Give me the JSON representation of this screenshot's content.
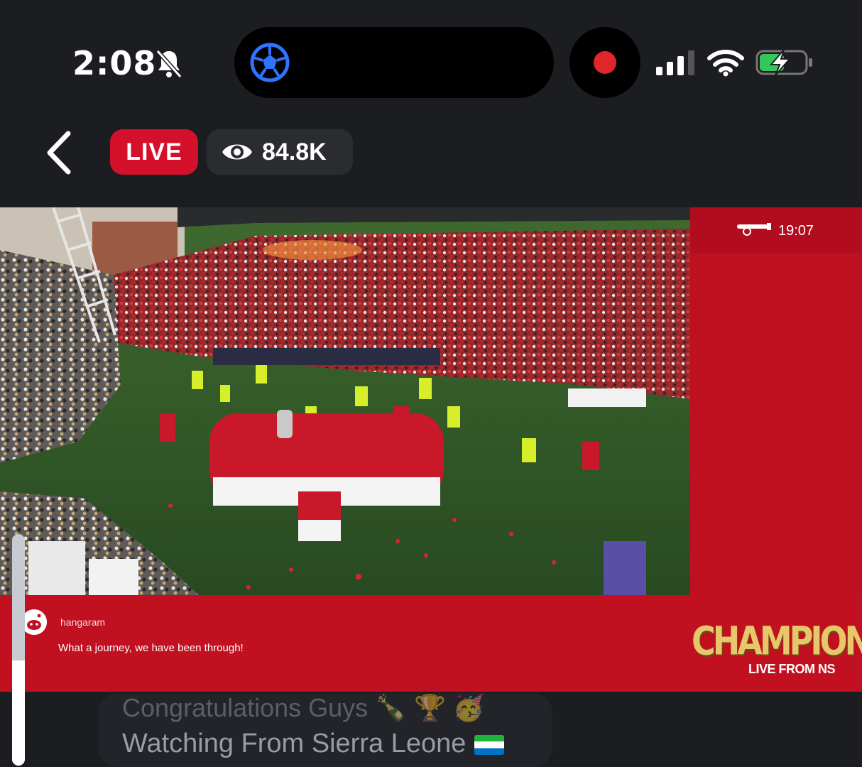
{
  "status_bar": {
    "time": "2:08",
    "icons": [
      "bell-slash-icon",
      "football-icon",
      "record-icon",
      "signal-icon",
      "wifi-icon",
      "battery-charging-icon"
    ]
  },
  "nav": {
    "back_icon": "chevron-left-icon",
    "live_label": "LIVE",
    "viewer_count": "84.8K"
  },
  "stream": {
    "match_clock": "19:07",
    "comment": {
      "username": "hangaram",
      "text": "What a journey, we have been through!"
    },
    "overlay": {
      "title": "CHAMPIONS",
      "subtitle": "LIVE FROM NS"
    }
  },
  "chat": {
    "line1": "Congratulations Guys",
    "line2": "Watching From Sierra Leone"
  },
  "colors": {
    "live_red": "#d5102a",
    "stream_red": "#bf1020",
    "gold": "#e8c66c"
  }
}
